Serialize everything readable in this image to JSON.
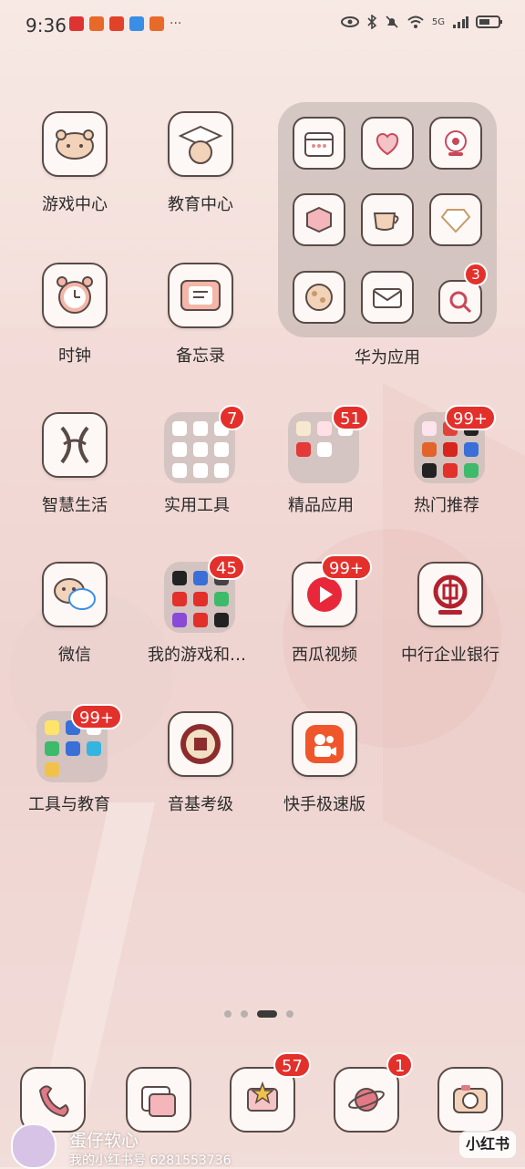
{
  "status_bar": {
    "time": "9:36",
    "network_label": "5G"
  },
  "apps": [
    {
      "label": "游戏中心",
      "icon": "game-controller-bear-icon"
    },
    {
      "label": "教育中心",
      "icon": "graduation-cap-icon"
    },
    {
      "label": "时钟",
      "icon": "alarm-clock-icon"
    },
    {
      "label": "备忘录",
      "icon": "notepad-icon"
    },
    {
      "label": "智慧生活",
      "icon": "smart-life-icon"
    },
    {
      "label": "实用工具",
      "icon": "folder-icon",
      "badge": "7"
    },
    {
      "label": "精品应用",
      "icon": "folder-icon",
      "badge": "51"
    },
    {
      "label": "热门推荐",
      "icon": "folder-icon",
      "badge": "99+"
    },
    {
      "label": "微信",
      "icon": "wechat-icon"
    },
    {
      "label": "我的游戏和…",
      "icon": "folder-icon",
      "badge": "45"
    },
    {
      "label": "西瓜视频",
      "icon": "xigua-video-icon",
      "badge": "99+"
    },
    {
      "label": "中行企业银行",
      "icon": "boc-bank-icon"
    },
    {
      "label": "工具与教育",
      "icon": "folder-icon",
      "badge": "99+"
    },
    {
      "label": "音基考级",
      "icon": "music-exam-icon"
    },
    {
      "label": "快手极速版",
      "icon": "kuaishou-icon"
    }
  ],
  "huawei_folder": {
    "label": "华为应用",
    "badge": "3",
    "items": [
      "calendar-icon",
      "health-icon",
      "camera-icon",
      "cube-icon",
      "teacup-icon",
      "diamond-icon",
      "cookie-icon",
      "envelope-icon",
      "search-icon"
    ]
  },
  "dock": [
    {
      "icon": "phone-icon"
    },
    {
      "icon": "gallery-icon"
    },
    {
      "icon": "star-mail-icon",
      "badge": "57"
    },
    {
      "icon": "planet-browser-icon",
      "badge": "1"
    },
    {
      "icon": "camera-icon"
    }
  ],
  "page_indicator": {
    "count": 4,
    "active": 2
  },
  "overlay": {
    "username": "蛋仔软心",
    "user_id": "我的小红书号 6281553736",
    "brand": "小红书"
  }
}
